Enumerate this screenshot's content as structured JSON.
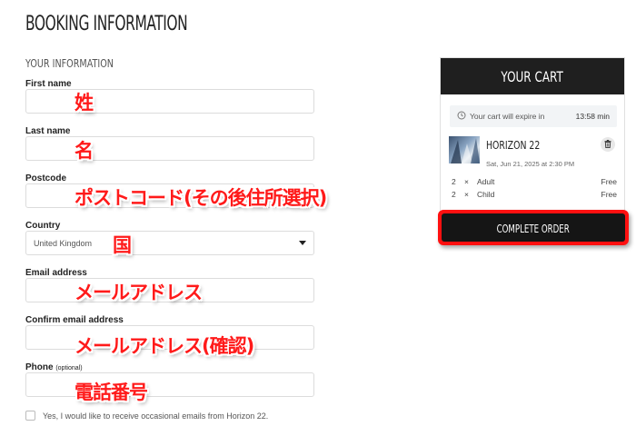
{
  "page": {
    "title": "BOOKING INFORMATION",
    "section_title": "YOUR INFORMATION"
  },
  "form": {
    "first_name_label": "First name",
    "last_name_label": "Last name",
    "postcode_label": "Postcode",
    "country_label": "Country",
    "country_value": "United Kingdom",
    "email_label": "Email address",
    "confirm_email_label": "Confirm email address",
    "phone_label": "Phone",
    "phone_optional": "(optional)",
    "consent_text": "Yes, I would like to receive occasional emails from Horizon 22."
  },
  "annotations": {
    "first_name": "姓",
    "last_name": "名",
    "postcode": "ポストコード(その後住所選択)",
    "country": "国",
    "email": "メールアドレス",
    "confirm_email": "メールアドレス(確認)",
    "phone": "電話番号"
  },
  "cart": {
    "title": "YOUR CART",
    "expiry_text": "Your cart will expire in",
    "expiry_time": "13:58 min",
    "event_name": "HORIZON 22",
    "event_date": "Sat, Jun 21, 2025 at 2:30 PM",
    "tickets": [
      {
        "qty": "2",
        "x": "×",
        "type": "Adult",
        "price": "Free"
      },
      {
        "qty": "2",
        "x": "×",
        "type": "Child",
        "price": "Free"
      }
    ],
    "complete_label": "COMPLETE ORDER"
  },
  "colors": {
    "annotation": "#ff1a1a",
    "cart_header": "#1f1f1f",
    "highlight_border": "#ff1010"
  },
  "icons": {
    "clock": "clock-icon",
    "trash": "trash-icon",
    "dropdown": "chevron-down-icon"
  }
}
